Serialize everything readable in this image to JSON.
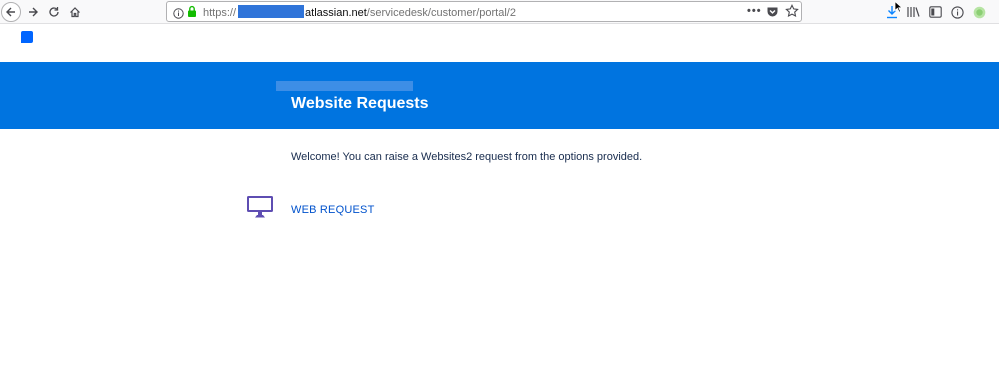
{
  "browser": {
    "url": {
      "scheme": "https://",
      "domain": "atlassian.net",
      "path": "/servicedesk/customer/portal/2"
    },
    "more_label": "•••",
    "icons": {
      "back": "back-arrow-icon",
      "forward": "forward-arrow-icon",
      "reload": "reload-icon",
      "home": "home-icon",
      "info": "info-icon",
      "lock": "lock-icon",
      "pocket": "pocket-icon",
      "bookmark": "star-icon",
      "download": "download-icon",
      "library": "library-icon",
      "sidebar": "sidebar-icon",
      "reader": "reader-icon",
      "extension": "extension-icon"
    }
  },
  "colors": {
    "banner": "#0074e0",
    "link": "#0052cc",
    "icon_purple": "#5e4db2"
  },
  "portal": {
    "title": "Website Requests",
    "welcome_text": "Welcome! You can raise a Websites2 request from the options provided.",
    "request_types": [
      {
        "label": "WEB REQUEST",
        "icon": "monitor-icon"
      }
    ]
  }
}
